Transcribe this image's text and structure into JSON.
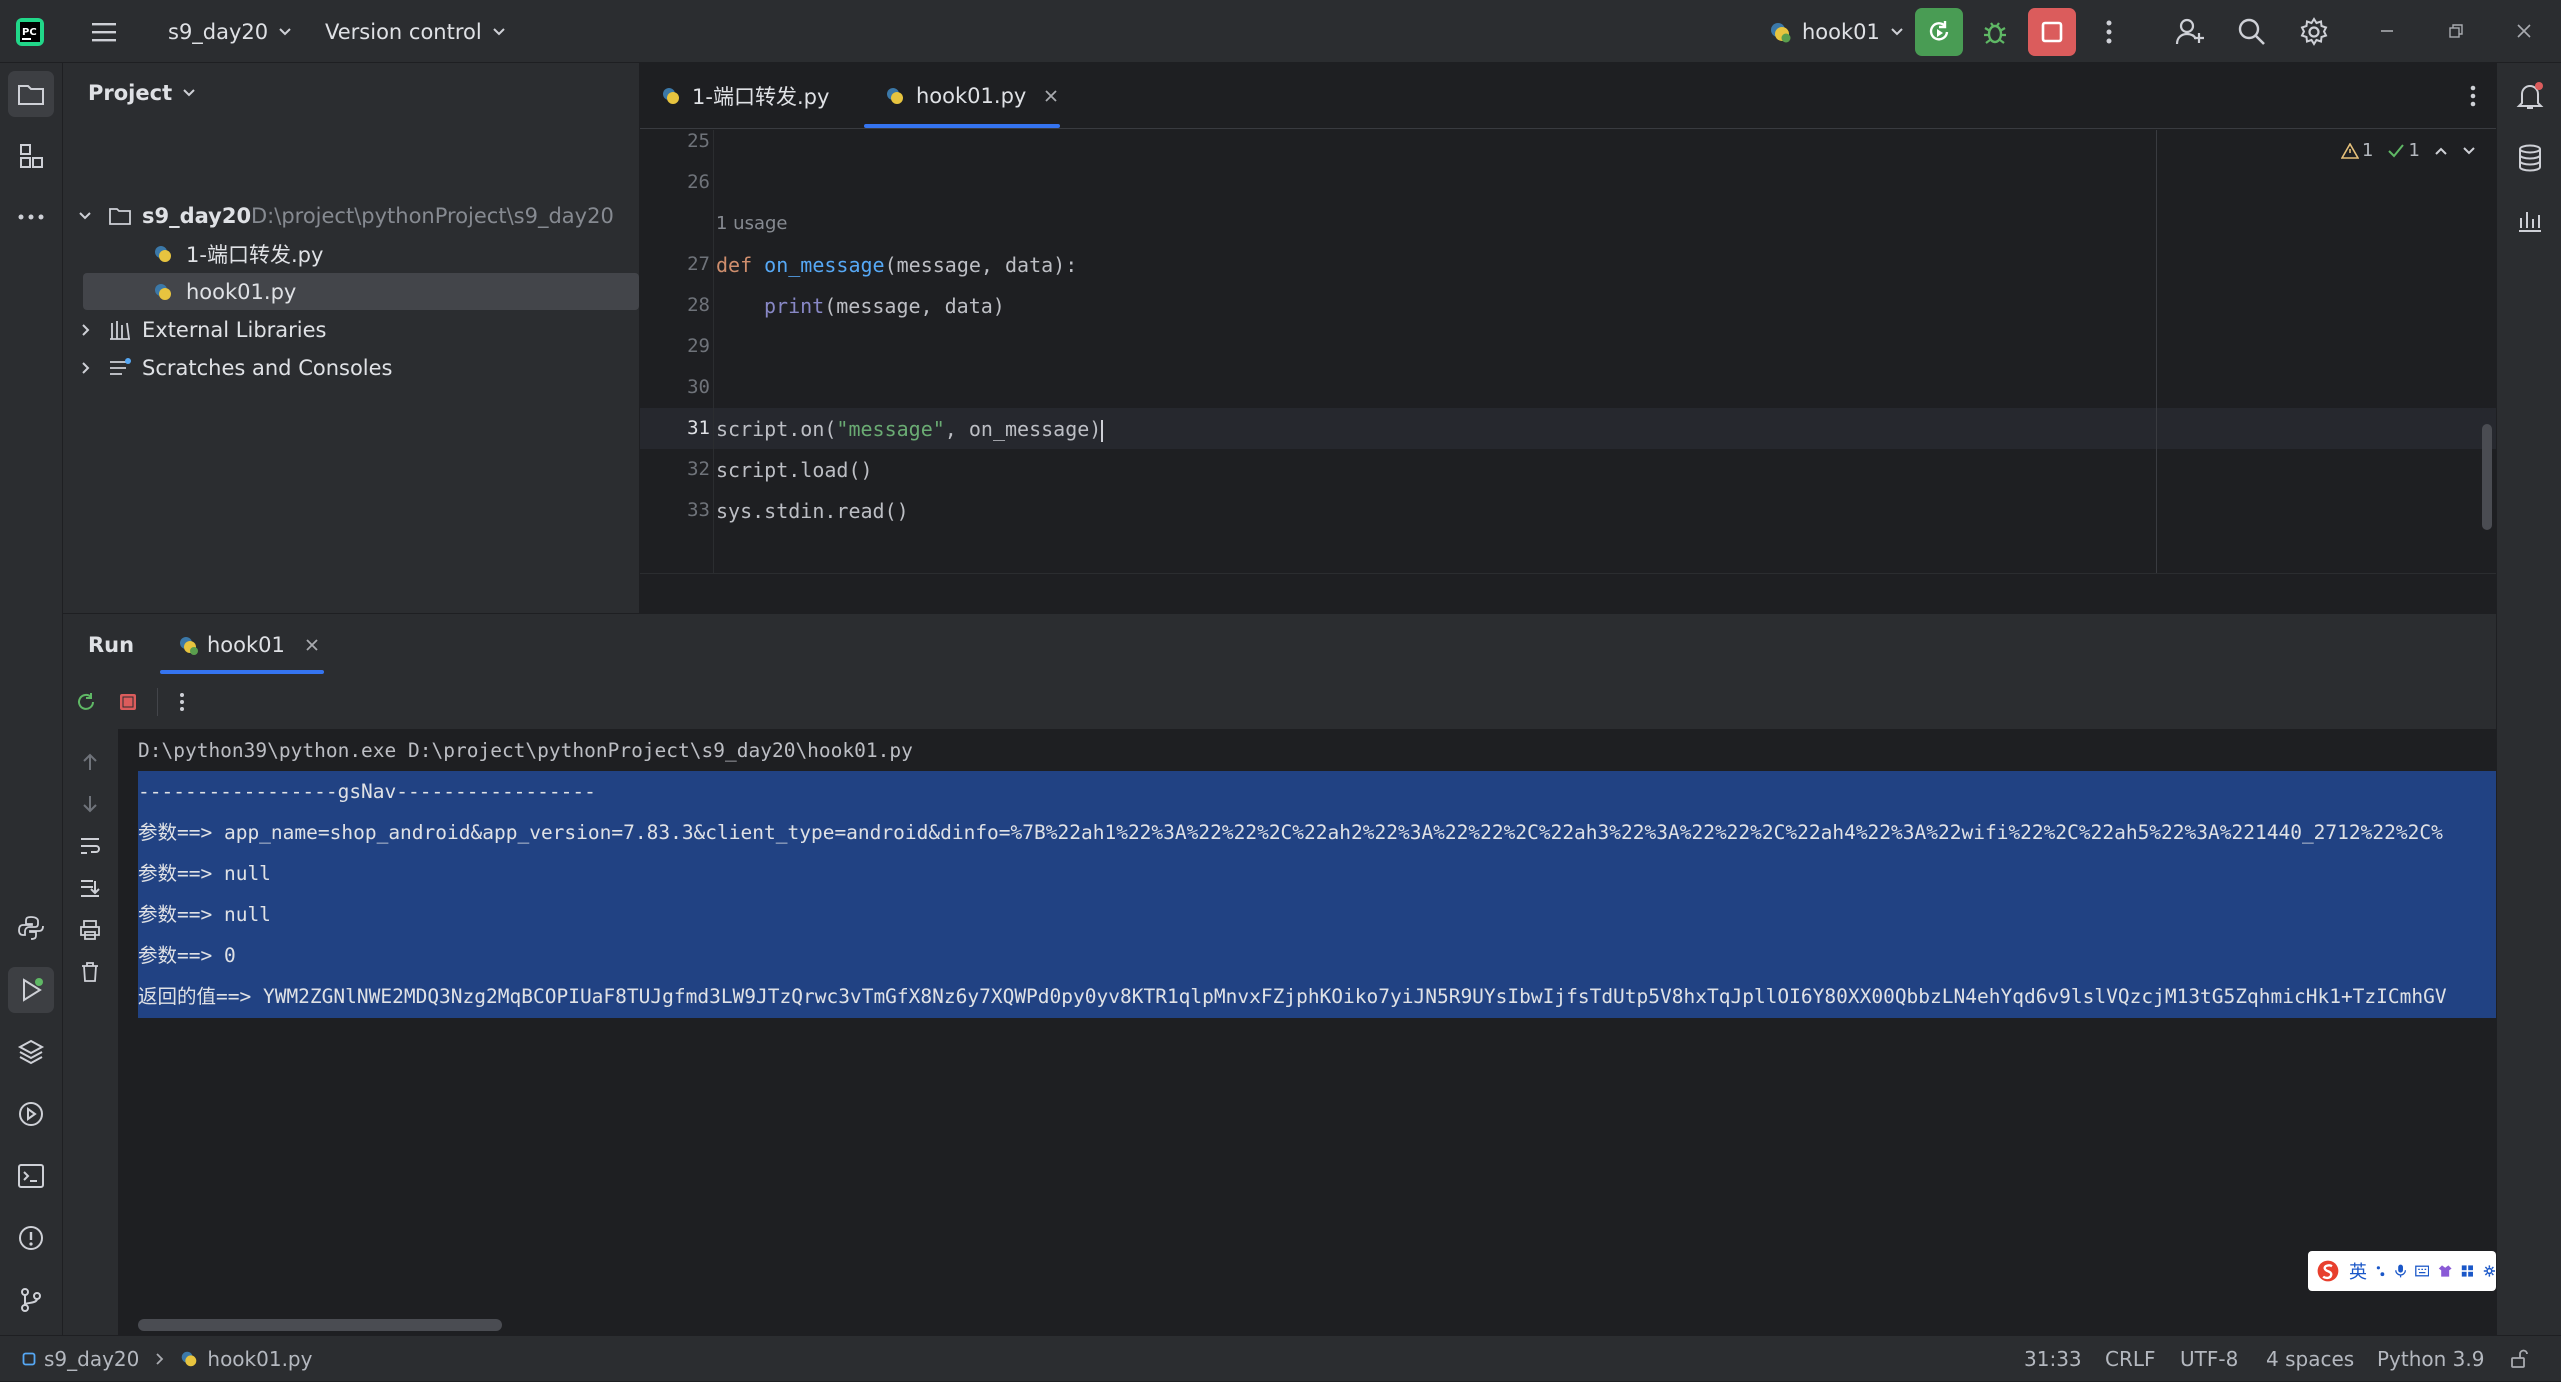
{
  "titlebar": {
    "project_name": "s9_day20",
    "version_control": "Version control",
    "run_config": "hook01"
  },
  "project_panel": {
    "title": "Project",
    "root_name": "s9_day20",
    "root_path": "D:\\project\\pythonProject\\s9_day20",
    "files": [
      "1-端口转发.py",
      "hook01.py"
    ],
    "external_libraries": "External Libraries",
    "scratches": "Scratches and Consoles"
  },
  "editor": {
    "tabs": [
      "1-端口转发.py",
      "hook01.py"
    ],
    "inspection_warnings": "1",
    "inspection_ok": "1",
    "usage_hint": "1 usage",
    "line_numbers": [
      "25",
      "26",
      "27",
      "28",
      "29",
      "30",
      "31",
      "32",
      "33"
    ],
    "code": {
      "l27_kw": "def ",
      "l27_fn": "on_message",
      "l27_rest": "(message, data):",
      "l28_fn": "print",
      "l28_rest": "(message, data)",
      "l31_a": "script.on(",
      "l31_str": "\"message\"",
      "l31_b": ", on_message)",
      "l32": "script.load()",
      "l33": "sys.stdin.read()"
    }
  },
  "run_panel": {
    "title": "Run",
    "tab": "hook01",
    "console_lines": [
      "D:\\python39\\python.exe D:\\project\\pythonProject\\s9_day20\\hook01.py",
      "-----------------gsNav-----------------",
      "参数==> app_name=shop_android&app_version=7.83.3&client_type=android&dinfo=%7B%22ah1%22%3A%22%22%2C%22ah2%22%3A%22%22%2C%22ah3%22%3A%22%22%2C%22ah4%22%3A%22wifi%22%2C%22ah5%22%3A%221440_2712%22%2C%",
      "参数==> null",
      "参数==> null",
      "参数==> 0",
      "返回的值==> YWM2ZGNlNWE2MDQ3Nzg2MqBCOPIUaF8TUJgfmd3LW9JTzQrwc3vTmGfX8Nz6y7XQWPd0py0yv8KTR1qlpMnvxFZjphKOiko7yiJN5R9UYsIbwIjfsTdUtp5V8hxTqJpllOI6Y80XX00QbbzLN4ehYqd6v9lslVQzcjM13tG5ZqhmicHk1+TzICmhGV"
    ]
  },
  "ime": {
    "lang": "英"
  },
  "statusbar": {
    "breadcrumb_project": "s9_day20",
    "breadcrumb_file": "hook01.py",
    "position": "31:33",
    "line_sep": "CRLF",
    "encoding": "UTF-8",
    "indent": "4 spaces",
    "interpreter": "Python 3.9"
  },
  "colors": {
    "accent": "#3574f0",
    "run_green": "#499c54",
    "stop_red": "#db5c5c",
    "selection": "#214283"
  }
}
